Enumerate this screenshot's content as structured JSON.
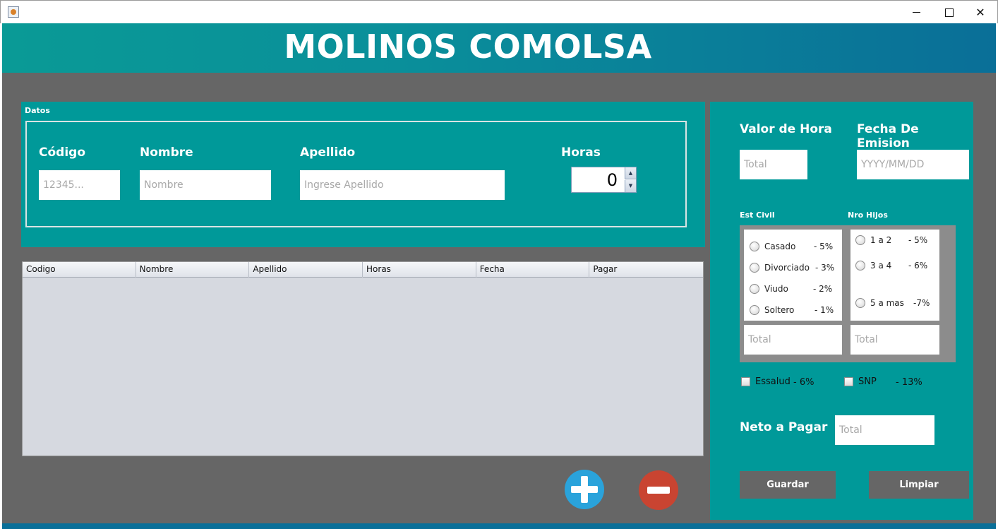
{
  "window": {
    "minimize_glyph": "",
    "maximize_glyph": "",
    "close_glyph": "✕"
  },
  "header": {
    "title": "MOLINOS COMOLSA"
  },
  "datos": {
    "legend": "Datos",
    "codigo": {
      "label": "Código",
      "placeholder": "12345..."
    },
    "nombre": {
      "label": "Nombre",
      "placeholder": "Nombre"
    },
    "apellido": {
      "label": "Apellido",
      "placeholder": "Ingrese Apellido"
    },
    "horas": {
      "label": "Horas",
      "value": "0"
    }
  },
  "table": {
    "columns": [
      "Codigo",
      "Nombre",
      "Apellido",
      "Horas",
      "Fecha",
      "Pagar"
    ],
    "rows": []
  },
  "right": {
    "valor_hora": {
      "label": "Valor de Hora",
      "placeholder": "Total"
    },
    "fecha_emision": {
      "label": "Fecha De Emision",
      "placeholder": "YYYY/MM/DD"
    },
    "est_civil": {
      "label": "Est Civil",
      "options": [
        {
          "label": "Casado",
          "pct": "- 5%"
        },
        {
          "label": "Divorciado",
          "pct": "- 3%"
        },
        {
          "label": "Viudo",
          "pct": "- 2%"
        },
        {
          "label": "Soltero",
          "pct": "- 1%"
        }
      ],
      "total_placeholder": "Total"
    },
    "nro_hijos": {
      "label": "Nro Hijos",
      "options": [
        {
          "label": "1  a  2",
          "pct": "- 5%"
        },
        {
          "label": "3  a  4",
          "pct": "- 6%"
        },
        {
          "label": "5  a  mas",
          "pct": "-7%"
        }
      ],
      "total_placeholder": "Total"
    },
    "essalud": {
      "label": "Essalud",
      "pct": "- 6%"
    },
    "snp": {
      "label": "SNP",
      "pct": "- 13%"
    },
    "neto": {
      "label": "Neto a Pagar",
      "placeholder": "Total"
    },
    "guardar_label": "Guardar",
    "limpiar_label": "Limpiar"
  },
  "icons": {
    "app": "java-app-icon",
    "add": "plus-icon",
    "remove": "minus-icon"
  },
  "colors": {
    "teal": "#009999",
    "header_gradient_start": "#0a9a96",
    "header_gradient_end": "#0a6f98",
    "frame_grey": "#666666",
    "add_blue": "#2aa3db",
    "remove_red": "#c94431"
  }
}
